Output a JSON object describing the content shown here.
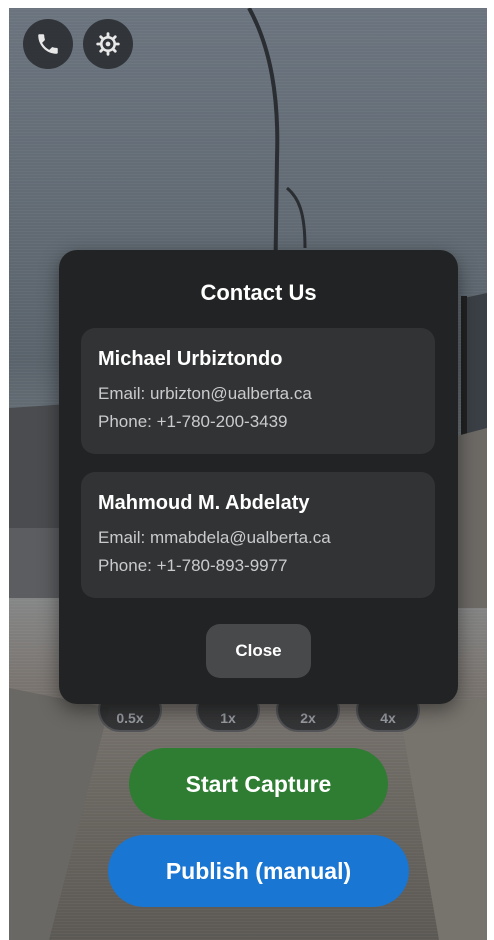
{
  "top_buttons": [
    {
      "icon": "phone-icon"
    },
    {
      "icon": "gear-icon"
    }
  ],
  "zoom_options": [
    "0.5x",
    "1x",
    "2x",
    "4x"
  ],
  "dialog": {
    "title": "Contact Us",
    "contacts": [
      {
        "name": "Michael Urbiztondo",
        "email": "Email: urbizton@ualberta.ca",
        "phone": "Phone: +1-780-200-3439"
      },
      {
        "name": "Mahmoud M. Abdelaty",
        "email": "Email: mmabdela@ualberta.ca",
        "phone": "Phone: +1-780-893-9977"
      }
    ],
    "close_label": "Close"
  },
  "actions": {
    "start_capture_label": "Start Capture",
    "publish_label": "Publish (manual)"
  },
  "colors": {
    "start_capture": "#2e7d32",
    "publish": "#1976d2",
    "dialog_bg": "#222324",
    "card_bg": "#323334"
  }
}
